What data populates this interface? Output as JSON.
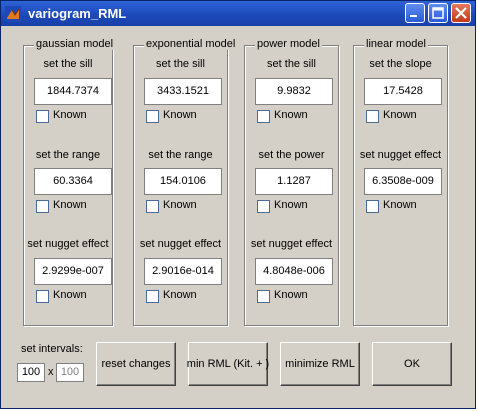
{
  "window": {
    "title": "variogram_RML"
  },
  "panels": [
    {
      "title": "gaussian model",
      "fields": [
        {
          "label": "set the sill",
          "value": "1844.7374",
          "known": "Known"
        },
        {
          "label": "set the range",
          "value": "60.3364",
          "known": "Known"
        },
        {
          "label": "set nugget effect",
          "value": "2.9299e-007",
          "known": "Known"
        }
      ]
    },
    {
      "title": "exponential model",
      "fields": [
        {
          "label": "set the sill",
          "value": "3433.1521",
          "known": "Known"
        },
        {
          "label": "set the range",
          "value": "154.0106",
          "known": "Known"
        },
        {
          "label": "set nugget effect",
          "value": "2.9016e-014",
          "known": "Known"
        }
      ]
    },
    {
      "title": "power model",
      "fields": [
        {
          "label": "set the sill",
          "value": "9.9832",
          "known": "Known"
        },
        {
          "label": "set the power",
          "value": "1.1287",
          "known": "Known"
        },
        {
          "label": "set nugget effect",
          "value": "4.8048e-006",
          "known": "Known"
        }
      ]
    },
    {
      "title": "linear model",
      "fields": [
        {
          "label": "set the slope",
          "value": "17.5428",
          "known": "Known"
        },
        {
          "label": "set nugget effect",
          "value": "6.3508e-009",
          "known": "Known"
        }
      ]
    }
  ],
  "intervals": {
    "label": "set intervals:",
    "x": "100",
    "sep": "x",
    "y": "100"
  },
  "buttons": {
    "reset": "reset changes",
    "min_rml": "min RML (Kit. + )",
    "minimize": "minimize RML",
    "ok": "OK"
  }
}
